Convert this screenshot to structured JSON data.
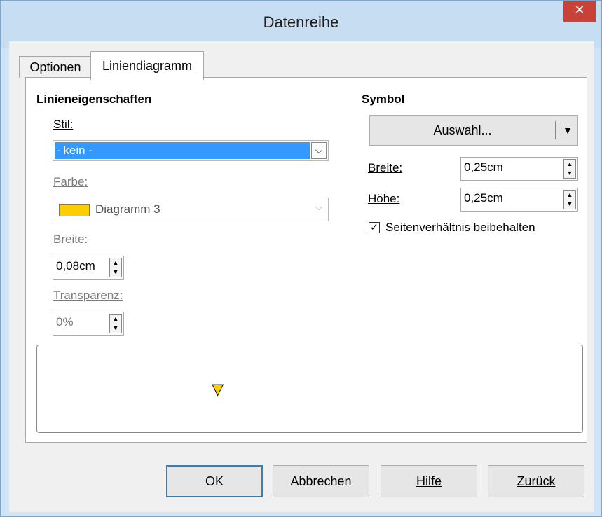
{
  "window": {
    "title": "Datenreihe",
    "close": "✕"
  },
  "tabs": [
    {
      "label": "Optionen"
    },
    {
      "label": "Liniendiagramm"
    }
  ],
  "line_props": {
    "heading": "Linieneigenschaften",
    "style_label": "Stil:",
    "style_value": "- kein -",
    "color_label": "Farbe:",
    "color_value": "Diagramm 3",
    "color_swatch": "#ffcc00",
    "width_label": "Breite:",
    "width_value": "0,08cm",
    "transparency_label": "Transparenz:",
    "transparency_value": "0%"
  },
  "symbol": {
    "heading": "Symbol",
    "select_label": "Auswahl...",
    "width_label": "Breite:",
    "width_value": "0,25cm",
    "height_label": "Höhe:",
    "height_value": "0,25cm",
    "keep_ratio_label": "Seitenverhältnis beibehalten",
    "keep_ratio_checked": true
  },
  "preview": {
    "marker": "▼",
    "marker_color": "#ffcc00"
  },
  "buttons": {
    "ok": "OK",
    "cancel": "Abbrechen",
    "help": "Hilfe",
    "back": "Zurück"
  }
}
